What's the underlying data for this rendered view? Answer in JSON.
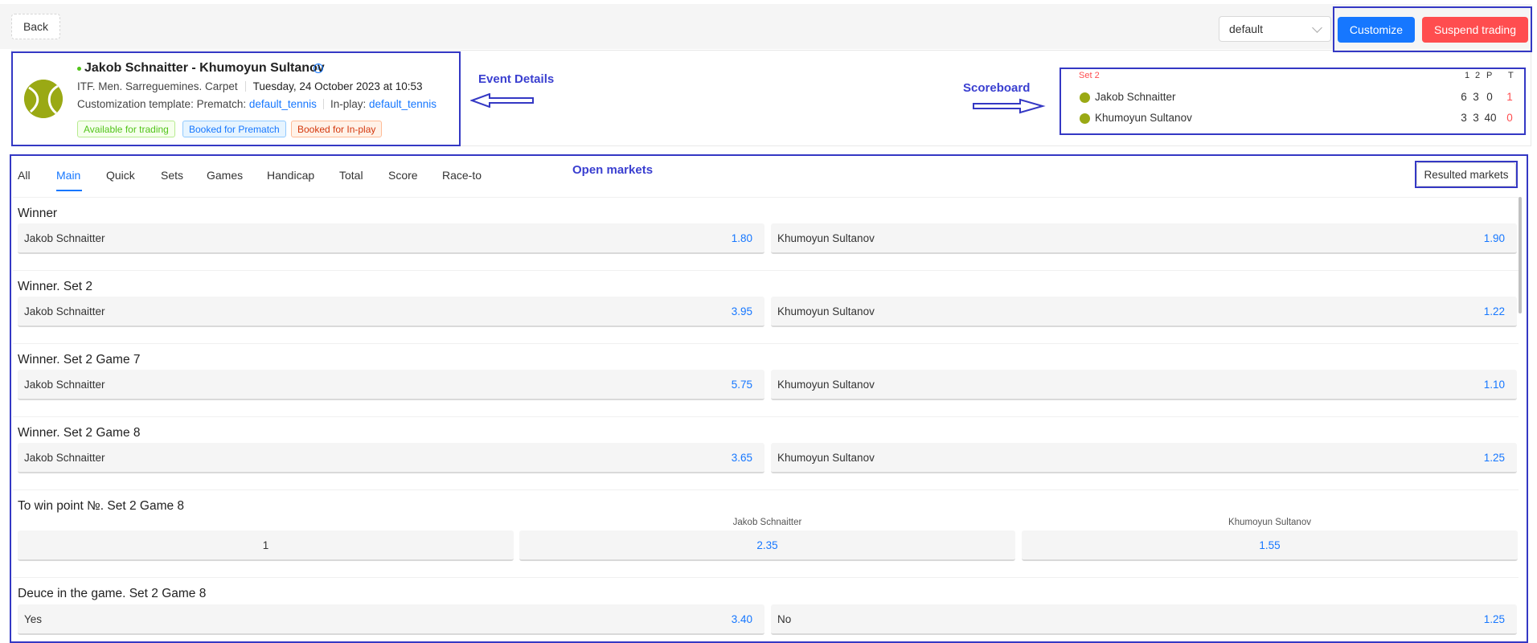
{
  "toolbar": {
    "back_label": "Back",
    "template_select_value": "default",
    "customize_label": "Customize",
    "suspend_label": "Suspend trading"
  },
  "event": {
    "title": "Jakob Schnaitter - Khumoyun Sultanov",
    "tournament": "ITF. Men. Sarreguemines. Carpet",
    "datetime": "Tuesday, 24 October 2023 at 10:53",
    "template_prefix": "Customization template: Prematch:",
    "prematch_template": "default_tennis",
    "inplay_prefix": "In-play:",
    "inplay_template": "default_tennis",
    "tags": [
      "Available for trading",
      "Booked for Prematch",
      "Booked for In-play"
    ]
  },
  "scoreboard": {
    "current_set": "Set 2",
    "columns": [
      "1",
      "2",
      "P",
      "T"
    ],
    "players": [
      {
        "name": "Jakob Schnaitter",
        "scores": [
          "6",
          "3",
          "0",
          "1"
        ]
      },
      {
        "name": "Khumoyun Sultanov",
        "scores": [
          "3",
          "3",
          "40",
          "0"
        ]
      }
    ]
  },
  "annotations": {
    "event_details": "Event Details",
    "scoreboard": "Scoreboard",
    "open_markets": "Open markets"
  },
  "tabs": [
    "All",
    "Main",
    "Quick",
    "Sets",
    "Games",
    "Handicap",
    "Total",
    "Score",
    "Race-to"
  ],
  "active_tab": "Main",
  "resulted_markets_label": "Resulted markets",
  "markets": [
    {
      "title": "Winner",
      "outcomes": [
        {
          "label": "Jakob Schnaitter",
          "price": "1.80"
        },
        {
          "label": "Khumoyun Sultanov",
          "price": "1.90"
        }
      ]
    },
    {
      "title": "Winner. Set 2",
      "outcomes": [
        {
          "label": "Jakob Schnaitter",
          "price": "3.95"
        },
        {
          "label": "Khumoyun Sultanov",
          "price": "1.22"
        }
      ]
    },
    {
      "title": "Winner. Set 2 Game 7",
      "outcomes": [
        {
          "label": "Jakob Schnaitter",
          "price": "5.75"
        },
        {
          "label": "Khumoyun Sultanov",
          "price": "1.10"
        }
      ]
    },
    {
      "title": "Winner. Set 2 Game 8",
      "outcomes": [
        {
          "label": "Jakob Schnaitter",
          "price": "3.65"
        },
        {
          "label": "Khumoyun Sultanov",
          "price": "1.25"
        }
      ]
    },
    {
      "title": "To win point №. Set 2 Game 8",
      "columns": [
        "Jakob Schnaitter",
        "Khumoyun Sultanov"
      ],
      "row": {
        "point": "1",
        "prices": [
          "2.35",
          "1.55"
        ]
      }
    },
    {
      "title": "Deuce in the game. Set 2 Game 8",
      "outcomes": [
        {
          "label": "Yes",
          "price": "3.40"
        },
        {
          "label": "No",
          "price": "1.25"
        }
      ]
    }
  ],
  "colors": {
    "primary": "#1677ff",
    "danger": "#ff4d4f",
    "annotation": "#3438c4",
    "tennis_ball": "#9aa914"
  }
}
